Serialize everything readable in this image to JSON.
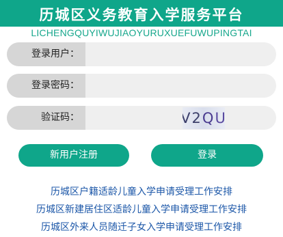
{
  "header": {
    "title": "历城区义务教育入学服务平台",
    "subtitle": "LICHENGQUYIWUJIAOYURUXUEFUWUPINGTAI"
  },
  "form": {
    "username": {
      "label": "登录用户：",
      "value": ""
    },
    "password": {
      "label": "登录密码：",
      "value": ""
    },
    "captcha": {
      "label": "验证码：",
      "value": "",
      "image_text": [
        "V",
        "2",
        "Q",
        "U"
      ]
    }
  },
  "buttons": {
    "register": "新用户注册",
    "login": "登录"
  },
  "links": [
    "历城区户籍适龄儿童入学申请受理工作安排",
    "历城区新建居住区适龄儿童入学申请受理工作安排",
    "历城区外来人员随迁子女入学申请受理工作安排"
  ],
  "colors": {
    "brand_green": "#0fa68a",
    "link_blue": "#1c57a8",
    "label_bg": "#d6d6d6",
    "input_bg": "#efefef"
  }
}
